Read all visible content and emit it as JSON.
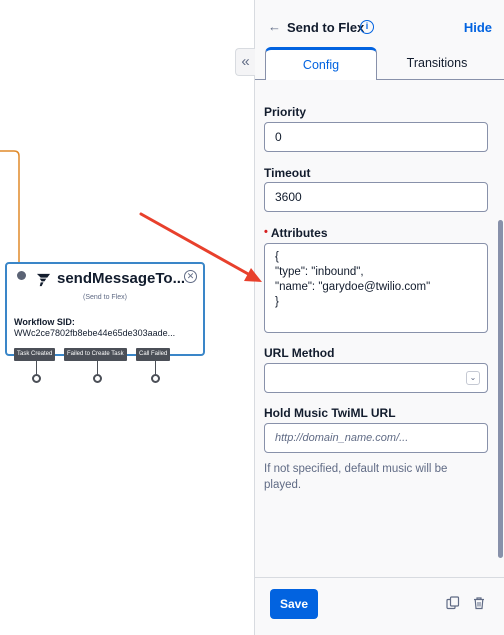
{
  "canvas": {
    "widget": {
      "title": "sendMessageTo...",
      "subtitle": "(Send to Flex)",
      "sid_label": "Workflow SID:",
      "sid_value": "WWc2ce7802fb8ebe44e65de303aade...",
      "transitions": [
        "Task Created",
        "Failed to Create Task",
        "Call Failed"
      ]
    }
  },
  "panel": {
    "header": {
      "title": "Send to Flex",
      "hide_label": "Hide"
    },
    "tabs": [
      {
        "label": "Config",
        "active": true
      },
      {
        "label": "Transitions",
        "active": false
      }
    ],
    "fields": {
      "priority": {
        "label": "Priority",
        "value": "0"
      },
      "timeout": {
        "label": "Timeout",
        "value": "3600"
      },
      "attributes": {
        "label": "Attributes",
        "required": "•",
        "value": "{\n\"type\": \"inbound\",\n\"name\": \"garydoe@twilio.com\"\n}"
      },
      "url_method": {
        "label": "URL Method",
        "value": ""
      },
      "hold_music": {
        "label": "Hold Music TwiML URL",
        "placeholder": "http://domain_name.com/...",
        "help": "If not specified, default music will be played."
      }
    },
    "footer": {
      "save_label": "Save"
    }
  },
  "colors": {
    "accent": "#0263e0",
    "widget_border": "#3a86c8",
    "wire": "#e08a2a",
    "annotation_arrow": "#e8402c",
    "required": "#d61f1f"
  }
}
